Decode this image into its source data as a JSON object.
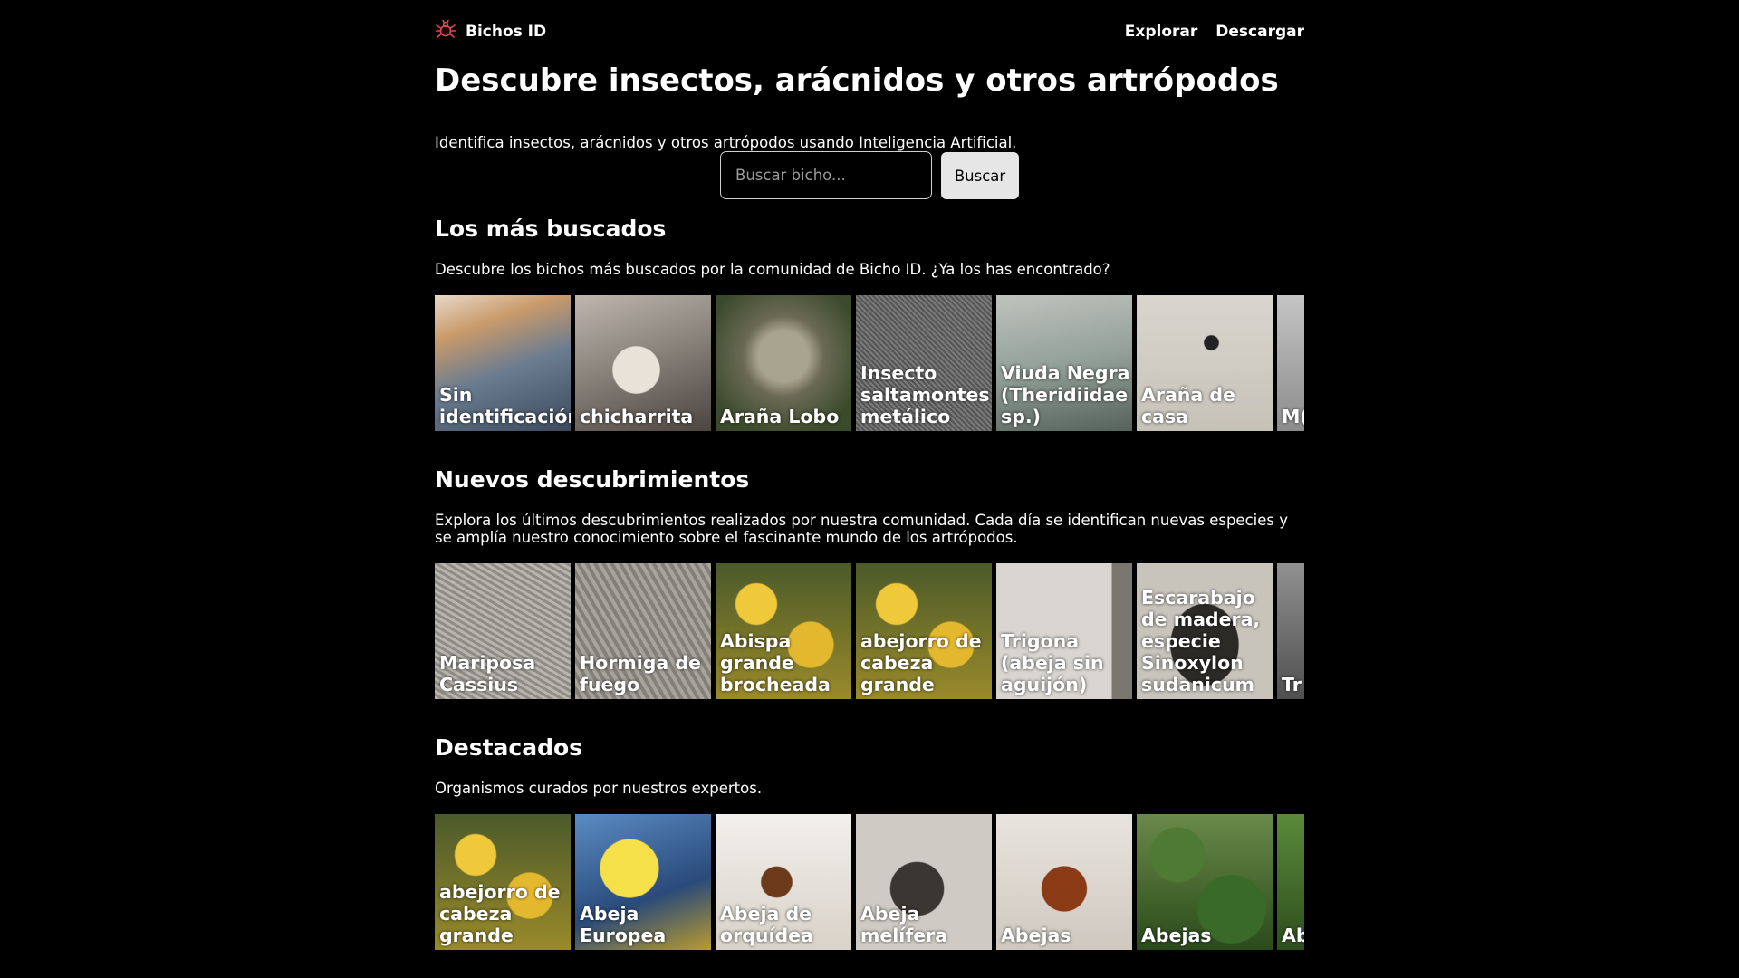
{
  "header": {
    "brand": "Bichos ID",
    "nav": [
      "Explorar",
      "Descargar"
    ]
  },
  "hero": {
    "title": "Descubre insectos, arácnidos y otros artrópodos",
    "subtitle": "Identifica insectos, arácnidos y otros artrópodos usando Inteligencia Artificial."
  },
  "search": {
    "placeholder": "Buscar bicho...",
    "button": "Buscar"
  },
  "sections": [
    {
      "title": "Los más buscados",
      "description": "Descubre los bichos más buscados por la comunidad de Bicho ID. ¿Ya los has encontrado?",
      "cards": [
        "Sin identificación",
        "chicharrita",
        "Araña Lobo",
        "Insecto saltamontes metálico",
        "Viuda Negra (Theridiidae sp.)",
        "Araña de casa",
        "M(C sp"
      ]
    },
    {
      "title": "Nuevos descubrimientos",
      "description": "Explora los últimos descubrimientos realizados por nuestra comunidad. Cada día se identifican nuevas especies y se amplía nuestro conocimiento sobre el fascinante mundo de los artrópodos.",
      "cards": [
        "Mariposa Cassius",
        "Hormiga de fuego",
        "Abispa grande brocheada",
        "abejorro de cabeza grande",
        "Trigona (abeja sin aguijón)",
        "Escarabajo de madera, especie Sinoxylon sudanicum",
        "Tr un es ac"
      ]
    },
    {
      "title": "Destacados",
      "description": "Organismos curados por nuestros expertos.",
      "cards": [
        "abejorro de cabeza grande",
        "Abeja Europea",
        "Abeja de orquídea",
        "Abeja melífera",
        "Abejas",
        "Abejas",
        "Ab"
      ]
    }
  ]
}
